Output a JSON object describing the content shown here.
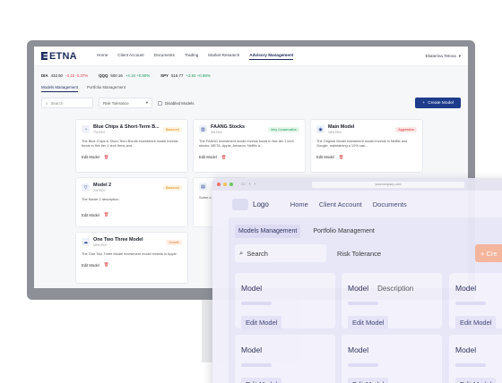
{
  "etna": {
    "logo": "ETNA",
    "nav": [
      "Home",
      "Client Account",
      "Documents",
      "Trading",
      "Market Research",
      "Advisory Management"
    ],
    "user": "Ekaterina Tetova",
    "tickers": [
      {
        "symbol": "DIA",
        "price": "432.50",
        "change": "-3.15 -0.37%",
        "dir": "neg"
      },
      {
        "symbol": "QQQ",
        "price": "500.16",
        "change": "+4.15 +0.90%",
        "dir": "pos"
      },
      {
        "symbol": "SPY",
        "price": "516.77",
        "change": "+3.84 +0.88%",
        "dir": "pos"
      }
    ],
    "tabs": [
      "Models Management",
      "Portfolio Management"
    ],
    "search_placeholder": "Search",
    "risk_select": "Risk Tolerance",
    "disabled_models": "Disabled Models",
    "create_button": "Create Model",
    "edit_label": "Edit Model",
    "cards": [
      {
        "title": "Blue Chips & Short-Term B...",
        "roi": "7% ROI",
        "badge": "Balanced",
        "badge_class": "balanced",
        "desc": "The Blue Chips & Short-Term Bonds investment model invests funds in five tier 1 tech firms and..."
      },
      {
        "title": "FAANG Stocks",
        "roi": "3% ROI",
        "badge": "Very Conservative",
        "badge_class": "conservative",
        "desc": "The FAANG investment model invests funds in five tier 1 tech stocks: META, Apple, Amazon, Netflix a..."
      },
      {
        "title": "Main Model",
        "roi": "10% ROI",
        "badge": "Aggressive",
        "badge_class": "aggressive",
        "desc": "The Original Model investment model invests in Netflix and Google, maintaining a 10% cas..."
      },
      {
        "title": "Model 2",
        "roi": "7% ROI",
        "badge": "Balanced",
        "badge_class": "balanced",
        "desc": "The Model 2 description"
      },
      {
        "title": "One Two Three Model",
        "roi": "10% ROI",
        "badge": "Growth",
        "badge_class": "growth",
        "desc": "The One Two Three Model investment model invests in Apple."
      }
    ],
    "partial_card_text": "Some o..."
  },
  "browser": {
    "url": "yourcompany.com",
    "logo": "Logo",
    "nav": [
      "Home",
      "Client Account",
      "Documents"
    ],
    "tabs": [
      "Models Management",
      "Portfolio Management"
    ],
    "search": "Search",
    "risk": "Risk Tolerance",
    "create": "+ Cre",
    "cards": [
      {
        "title": "Model",
        "desc": ""
      },
      {
        "title": "Model",
        "desc": "Description"
      },
      {
        "title": "Model",
        "desc": ""
      },
      {
        "title": "Model",
        "desc": ""
      },
      {
        "title": "Model",
        "desc": ""
      },
      {
        "title": "Model",
        "desc": ""
      }
    ],
    "edit_label": "Edit Model"
  },
  "colors": {
    "accent": "#1d3c8c",
    "brand_dark": "#1d2c5c",
    "overlay_bg": "#e8e7f8",
    "create_peach": "#f4b29a"
  }
}
